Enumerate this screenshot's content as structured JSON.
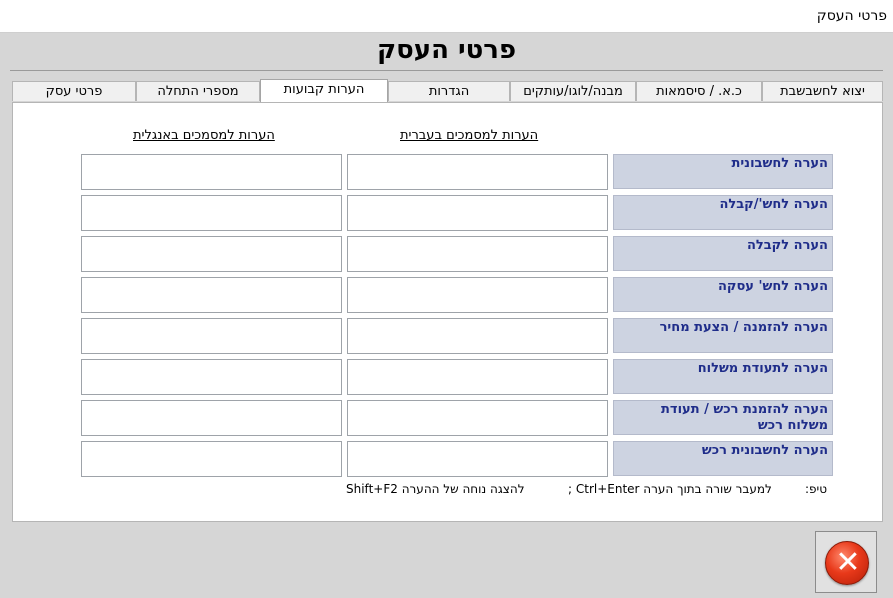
{
  "window": {
    "title": "פרטי העסק"
  },
  "header": {
    "title": "פרטי העסק"
  },
  "tabs": [
    {
      "label": "יצוא לחשבשבת"
    },
    {
      "label": "כ.א. / סיסמאות"
    },
    {
      "label": "מבנה/לוגו/עותקים"
    },
    {
      "label": "הגדרות"
    },
    {
      "label": "הערות קבועות",
      "active": true
    },
    {
      "label": "מספרי התחלה"
    },
    {
      "label": "פרטי עסק"
    }
  ],
  "columns": {
    "hebrew": "הערות למסמכים בעברית",
    "english": "הערות למסמכים באנגלית"
  },
  "rows": [
    {
      "label": "הערה לחשבונית",
      "hebrew": "",
      "english": ""
    },
    {
      "label": "הערה לחש'/קבלה",
      "hebrew": "",
      "english": ""
    },
    {
      "label": "הערה לקבלה",
      "hebrew": "",
      "english": ""
    },
    {
      "label": "הערה לחש' עסקה",
      "hebrew": "",
      "english": ""
    },
    {
      "label": "הערה להזמנה / הצעת מחיר",
      "hebrew": "",
      "english": ""
    },
    {
      "label": "הערה לתעודת משלוח",
      "hebrew": "",
      "english": ""
    },
    {
      "label": "הערה להזמנת רכש / תעודת משלוח רכש",
      "hebrew": "",
      "english": ""
    },
    {
      "label": "הערה לחשבונית רכש",
      "hebrew": "",
      "english": ""
    }
  ],
  "tip": {
    "label": "טיפ:",
    "line1": "למעבר שורה בתוך הערה Ctrl+Enter ;",
    "line2": "להצגה נוחה של ההערה Shift+F2"
  },
  "close_button": {
    "icon": "close-icon",
    "color": "#e8391a"
  }
}
